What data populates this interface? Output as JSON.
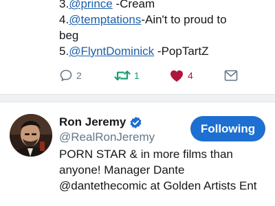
{
  "tweet": {
    "lines": [
      {
        "num": "3.",
        "mention": "@prince",
        "rest": " -Cream"
      },
      {
        "num": "4.",
        "mention": "@temptations",
        "rest": "-Ain't to proud to"
      },
      {
        "num": "",
        "mention": "",
        "rest": "beg"
      },
      {
        "num": "5.",
        "mention": "@FlyntDominick",
        "rest": " -PopTartZ"
      }
    ],
    "actions": {
      "reply_count": "2",
      "retweet_count": "1",
      "like_count": "4"
    }
  },
  "profile": {
    "display_name": "Ron Jeremy",
    "handle": "@RealRonJeremy",
    "follow_label": "Following",
    "bio": "PORN STAR & in more films than anyone! Manager Dante @dantethecomic at Golden Artists Ent"
  },
  "colors": {
    "link": "#1b5fa8",
    "retweet": "#17a06e",
    "like": "#b0163d",
    "follow_button": "#1d6fd1",
    "secondary_text": "#657786"
  },
  "icons": [
    "reply-icon",
    "retweet-icon",
    "like-icon",
    "message-icon",
    "verified-badge-icon"
  ]
}
